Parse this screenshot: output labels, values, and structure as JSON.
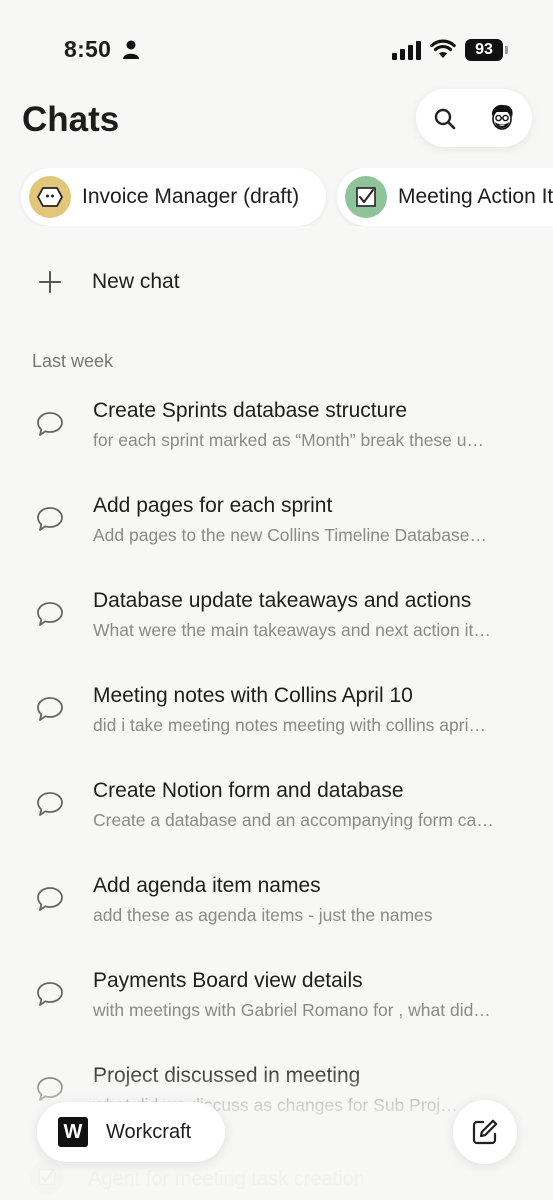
{
  "status_bar": {
    "time": "8:50",
    "battery": "93"
  },
  "header": {
    "title": "Chats"
  },
  "chips": [
    {
      "label": "Invoice Manager (draft)",
      "icon": "invoice-agent-icon",
      "color": "#e2c67a"
    },
    {
      "label": "Meeting Action Items",
      "icon": "checklist-icon",
      "color": "#8fc49b"
    }
  ],
  "new_chat": {
    "label": "New chat"
  },
  "section": {
    "label": "Last week"
  },
  "chats": [
    {
      "title": "Create Sprints database structure",
      "preview": "for each sprint marked as “Month” break these u…"
    },
    {
      "title": "Add pages for each sprint",
      "preview": "Add pages to the new Collins Timeline Database…"
    },
    {
      "title": "Database update takeaways and actions",
      "preview": "What were the main takeaways and next action it…"
    },
    {
      "title": "Meeting notes with Collins April 10",
      "preview": "did i take meeting notes meeting with collins apri…"
    },
    {
      "title": "Create Notion form and database",
      "preview": "Create a database and an accompanying form ca…"
    },
    {
      "title": "Add agenda item names",
      "preview": "add these as agenda items - just the names"
    },
    {
      "title": "Payments Board view details",
      "preview": "with meetings with Gabriel Romano for , what did…"
    },
    {
      "title": "Project discussed in meeting",
      "preview": "what did we discuss as changes for Sub Proj…"
    }
  ],
  "ghost_item": {
    "label": "Agent for meeting task creation"
  },
  "workspace": {
    "logo": "W",
    "name": "Workcraft"
  }
}
